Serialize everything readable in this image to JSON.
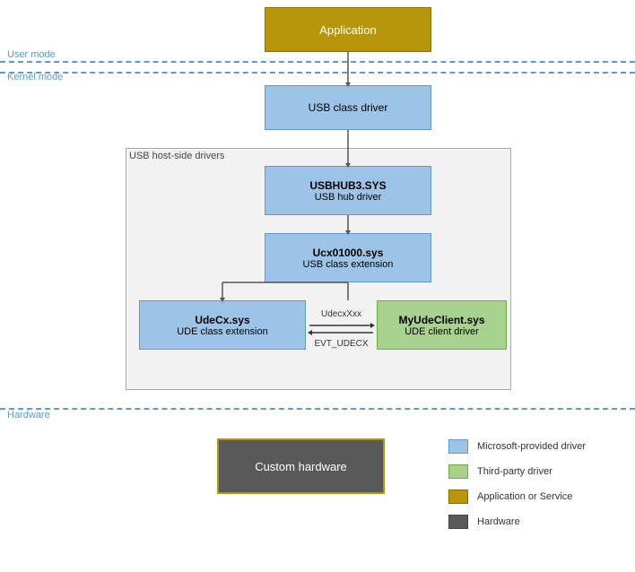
{
  "diagram": {
    "application": {
      "label": "Application"
    },
    "modes": {
      "user_mode_label": "User mode",
      "kernel_mode_label": "Kernel mode"
    },
    "usb_class_driver": {
      "label": "USB class driver"
    },
    "usb_host_container_label": "USB host-side drivers",
    "usbhub": {
      "title": "USBHUB3.SYS",
      "subtitle": "USB hub driver"
    },
    "ucx": {
      "title": "Ucx01000.sys",
      "subtitle": "USB class extension"
    },
    "udecx": {
      "title": "UdeCx.sys",
      "subtitle": "UDE class extension"
    },
    "myude": {
      "title": "MyUdeClient.sys",
      "subtitle": "UDE client driver"
    },
    "arrow_labels": {
      "top": "UdecxXxx",
      "bottom": "EVT_UDECX"
    },
    "hardware_label": "Hardware",
    "custom_hardware": {
      "label": "Custom hardware"
    },
    "legend": {
      "items": [
        {
          "color": "#9dc3e6",
          "border": "#5b9bd5",
          "text": "Microsoft-provided driver"
        },
        {
          "color": "#a9d18e",
          "border": "#70ad47",
          "text": "Third-party driver"
        },
        {
          "color": "#b8960c",
          "border": "#8a6e00",
          "text": "Application or Service"
        },
        {
          "color": "#595959",
          "border": "#444",
          "text": "Hardware"
        }
      ]
    }
  }
}
